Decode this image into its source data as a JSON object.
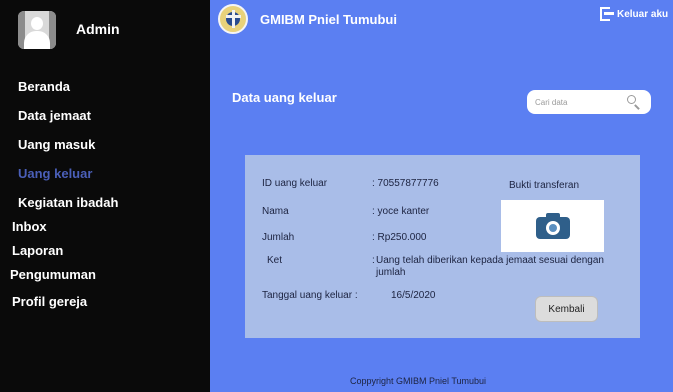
{
  "sidebar": {
    "admin_label": "Admin",
    "items": [
      {
        "label": "Beranda"
      },
      {
        "label": "Data jemaat"
      },
      {
        "label": "Uang masuk"
      },
      {
        "label": "Uang keluar"
      },
      {
        "label": "Kegiatan ibadah"
      },
      {
        "label": "Inbox"
      },
      {
        "label": "Laporan"
      },
      {
        "label": "Pengumuman"
      },
      {
        "label": "Profil gereja"
      }
    ],
    "active_item": "Uang keluar",
    "active_color": "#4a5fb8"
  },
  "header": {
    "title": "GMIBM Pniel Tumubui",
    "logout_label": "Keluar aku"
  },
  "main": {
    "heading": "Data uang keluar",
    "search": {
      "placeholder": "Cari data"
    },
    "detail": {
      "id_label": "ID uang keluar",
      "id_value": ": 70557877776",
      "nama_label": "Nama",
      "nama_value": ":  yoce kanter",
      "jumlah_label": "Jumlah",
      "jumlah_value": ":  Rp250.000",
      "ket_label": "Ket",
      "ket_colon": ":",
      "ket_value": "Uang telah diberikan kepada jemaat sesuai dengan jumlah",
      "tanggal_label": "Tanggal uang keluar  :",
      "tanggal_value": "16/5/2020",
      "bukti_label": "Bukti transferan",
      "back_label": "Kembali"
    },
    "footer": "Coppyright GMIBM Pniel Tumubui"
  },
  "colors": {
    "sidebar_bg": "#0a0a0a",
    "main_bg": "#5b7ff2",
    "card_bg": "#a9bde8"
  }
}
